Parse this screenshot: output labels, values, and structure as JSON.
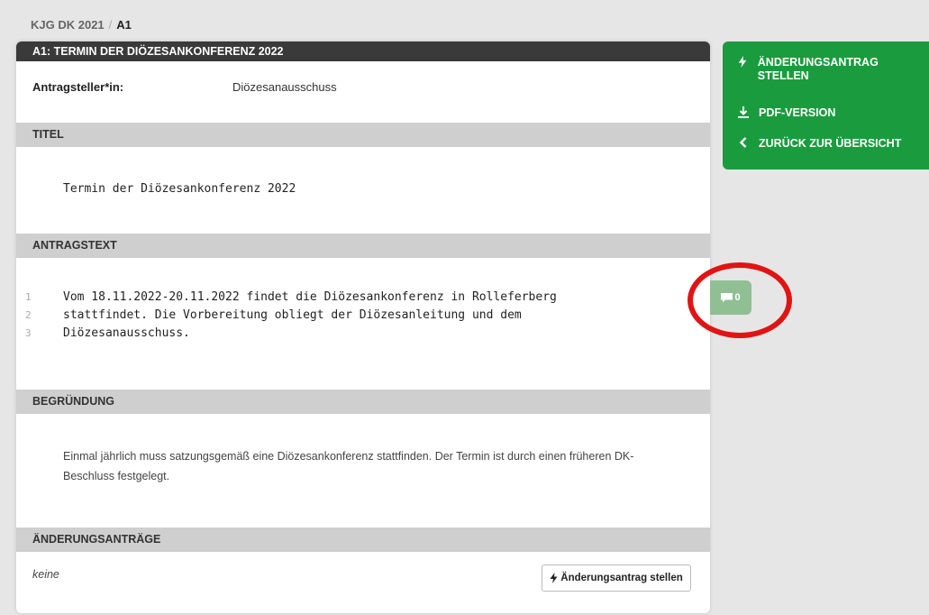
{
  "breadcrumb": {
    "parent": "KJG DK 2021",
    "separator": "/",
    "current": "A1"
  },
  "card": {
    "header": "A1: TERMIN DER DIÖZESANKONFERENZ 2022",
    "applicant_label": "Antragsteller*in:",
    "applicant_value": "Diözesanausschuss",
    "title_section": "TITEL",
    "title_text": "Termin der Diözesankonferenz 2022",
    "motion_section": "ANTRAGSTEXT",
    "motion_lines": [
      {
        "num": "1",
        "text": "Vom 18.11.2022-20.11.2022 findet die Diözesankonferenz in Rolleferberg"
      },
      {
        "num": "2",
        "text": "stattfindet. Die Vorbereitung obliegt der Diözesanleitung und dem"
      },
      {
        "num": "3",
        "text": "Diözesanausschuss."
      }
    ],
    "reason_section": "BEGRÜNDUNG",
    "reason_text": "Einmal jährlich muss satzungsgemäß eine Diözesankonferenz stattfinden. Der Termin ist durch einen früheren DK-Beschluss festgelegt.",
    "amendments_section": "ÄNDERUNGSANTRÄGE",
    "amendments_none": "keine",
    "amend_button": "Änderungsantrag stellen"
  },
  "sidebar": {
    "items": [
      {
        "icon": "bolt-icon",
        "label": "ÄNDERUNGSANTRAG STELLEN"
      },
      {
        "icon": "download-icon",
        "label": "PDF-VERSION"
      },
      {
        "icon": "chevron-left-icon",
        "label": "ZURÜCK ZUR ÜBERSICHT"
      }
    ]
  },
  "comments": {
    "count": "0"
  },
  "colors": {
    "sidebar_green": "#1a9c3e",
    "header_dark": "#3a3a3a",
    "section_gray": "#cfcfcf",
    "highlight_red": "#e01414"
  }
}
